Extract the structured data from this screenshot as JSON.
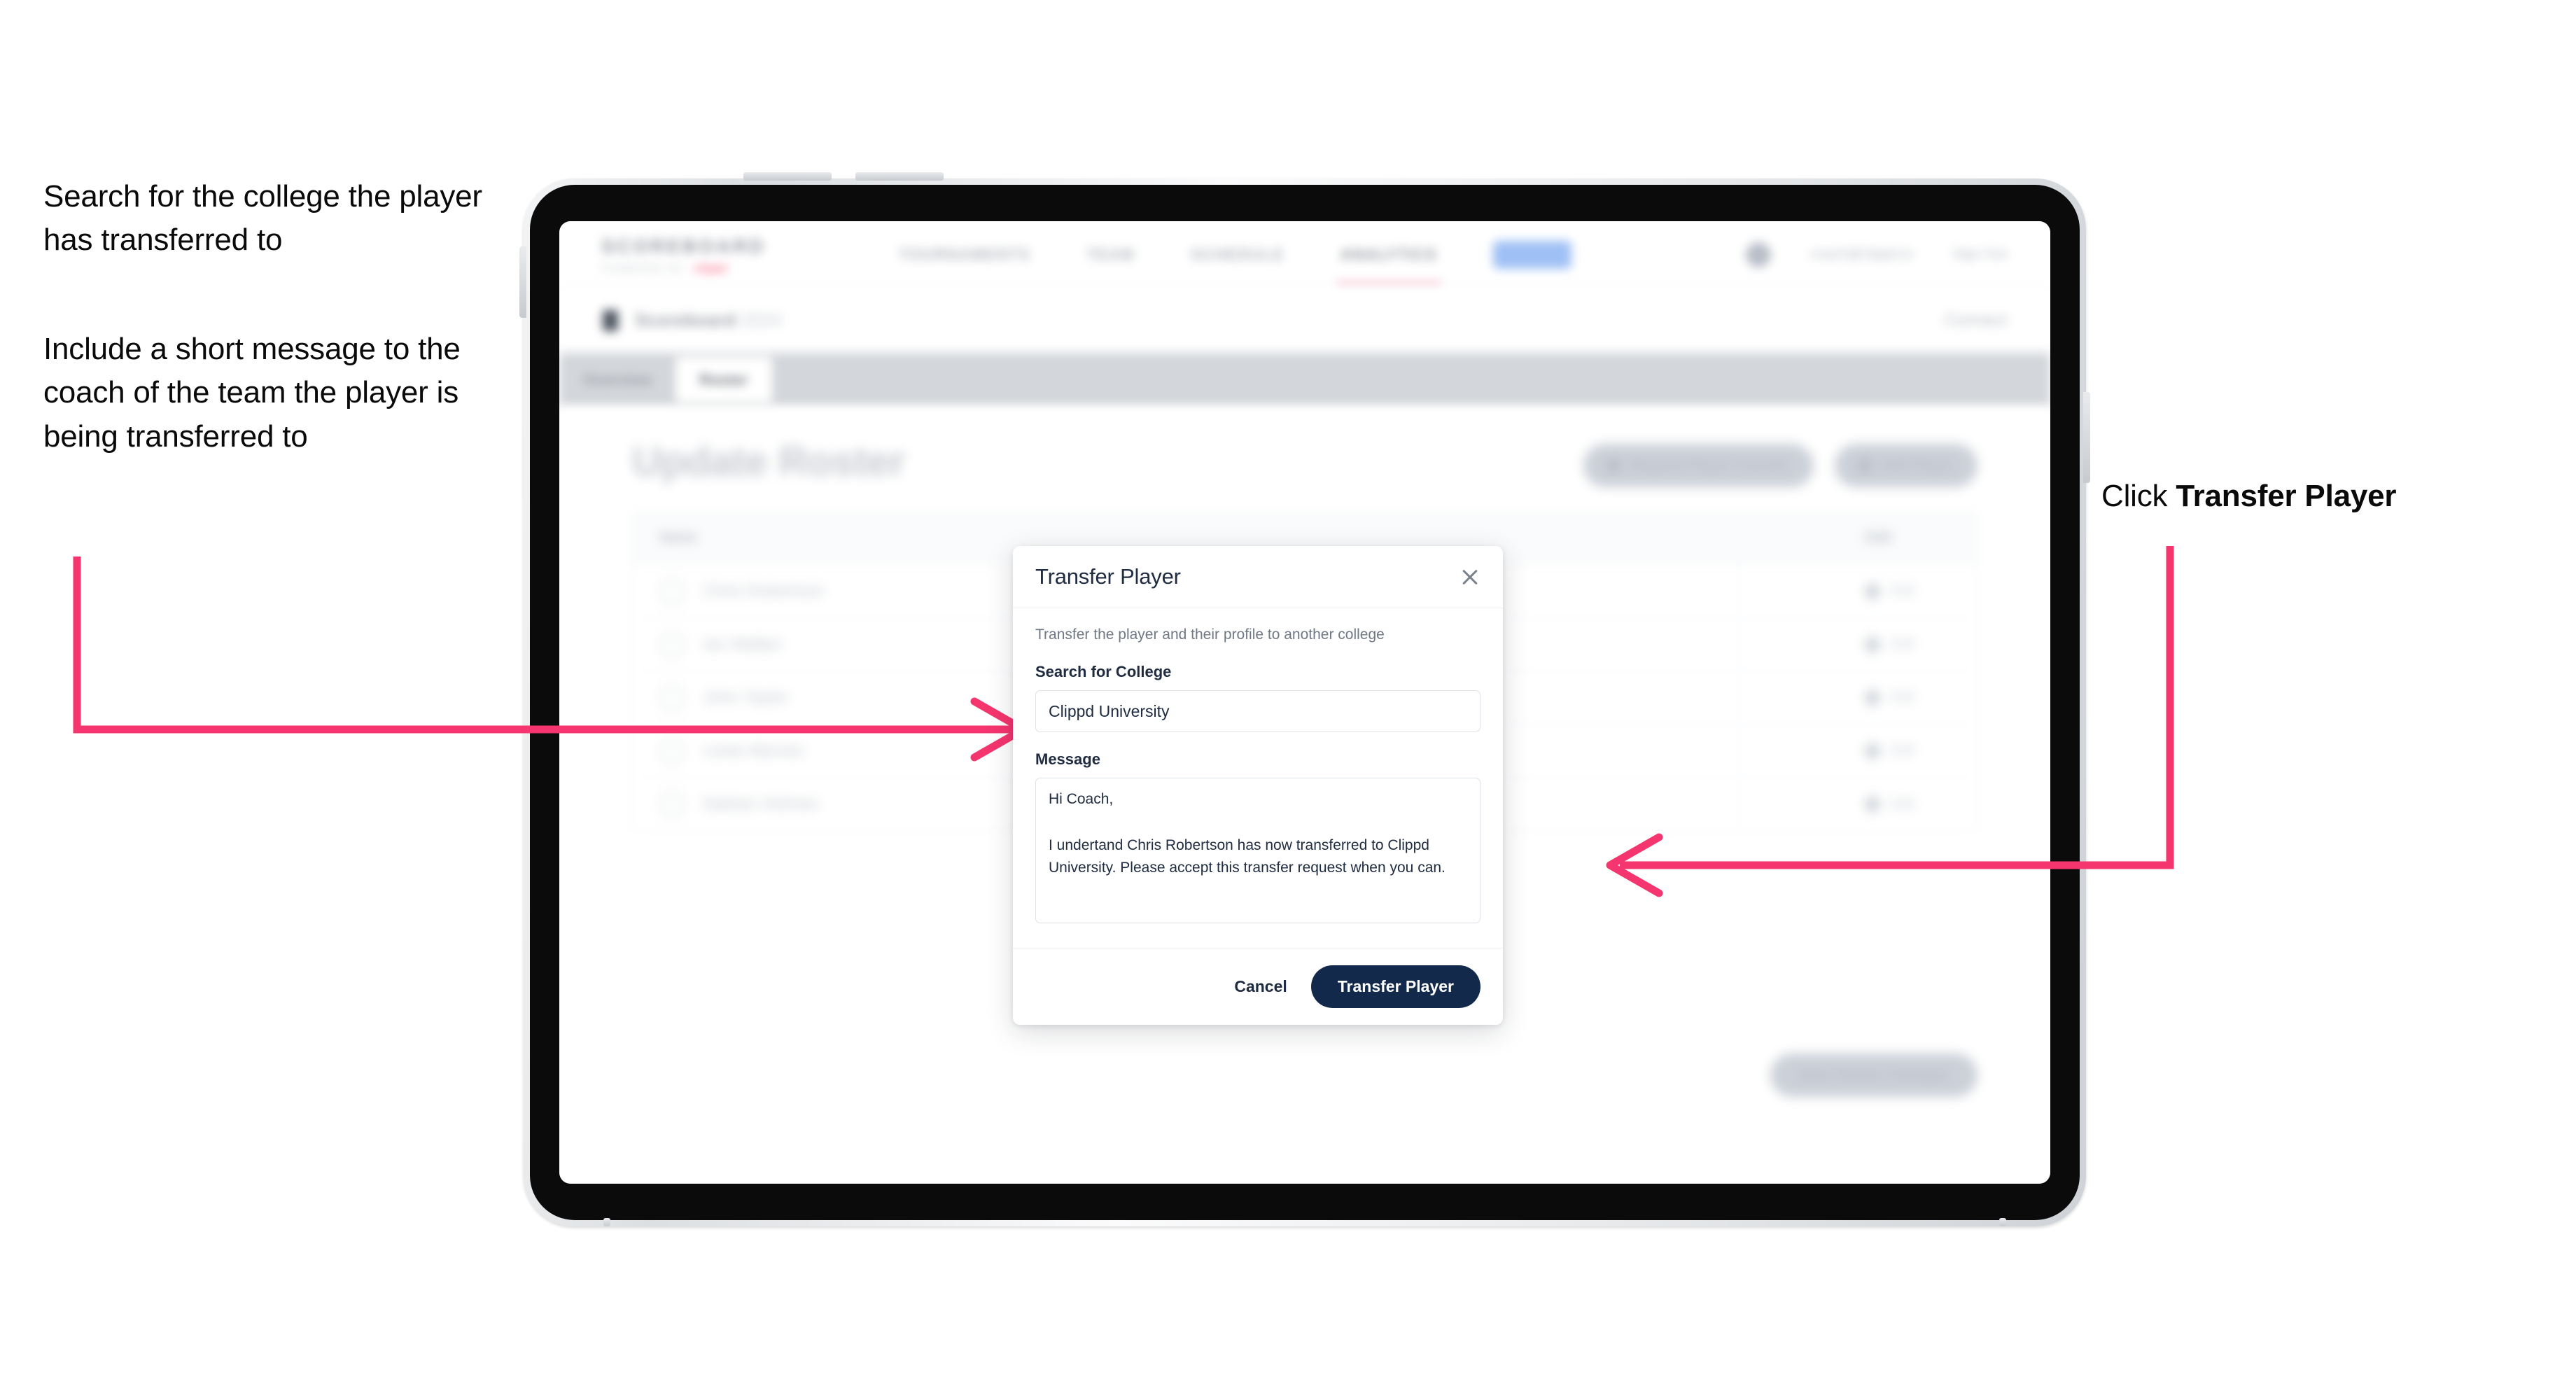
{
  "annotations": {
    "left_top": "Search for the college the player has transferred to",
    "left_bottom": "Include a short message to the coach of the team the player is being transferred to",
    "right_prefix": "Click ",
    "right_strong": "Transfer Player"
  },
  "colors": {
    "accent_pink": "#f5356e",
    "navy": "#13294b",
    "modal_title": "#1f2b40",
    "muted_text": "#6f7885"
  },
  "app": {
    "brand": {
      "word": "SCOREBOARD",
      "sub": "POWERED BY",
      "sub_accent": "clippd"
    },
    "nav": {
      "links": [
        "TOURNAMENTS",
        "TEAM",
        "SCHEDULE",
        "ANALYTICS"
      ],
      "active": "ROSTER",
      "pill_label": "ROSTER"
    },
    "nav_right": {
      "email": "coach@clippd.io",
      "sign_out": "Sign Out",
      "avatar": "user-avatar"
    },
    "breadcrumb": {
      "icon": "trophy-icon",
      "label": "Scoreboard",
      "sub": "2024",
      "right": "Connect"
    },
    "tabs": [
      {
        "label": "Overview",
        "active": false
      },
      {
        "label": "Roster",
        "active": true
      }
    ],
    "page_title": "Update Roster",
    "header_buttons": [
      {
        "icon": "transfer-icon",
        "label": "Request Player Transfer"
      },
      {
        "icon": "plus-icon",
        "label": "Add Player"
      }
    ],
    "roster": {
      "columns": [
        "Name",
        "Edit"
      ],
      "rows": [
        {
          "name": "Chris Robertson",
          "action": "Edit"
        },
        {
          "name": "Ian Walker",
          "action": "Edit"
        },
        {
          "name": "John Taylor",
          "action": "Edit"
        },
        {
          "name": "Lewis Barnes",
          "action": "Edit"
        },
        {
          "name": "Nathan Holmes",
          "action": "Edit"
        }
      ]
    },
    "bottom_button": "Save Roster Changes"
  },
  "modal": {
    "title": "Transfer Player",
    "close_icon": "close-icon",
    "description": "Transfer the player and their profile to another college",
    "college_label": "Search for College",
    "college_value": "Clippd University",
    "college_placeholder": "Search for College",
    "message_label": "Message",
    "message_value": "Hi Coach,\n\nI undertand Chris Robertson has now transferred to Clippd University. Please accept this transfer request when you can.",
    "message_placeholder": "Message",
    "cancel_label": "Cancel",
    "submit_label": "Transfer Player"
  }
}
